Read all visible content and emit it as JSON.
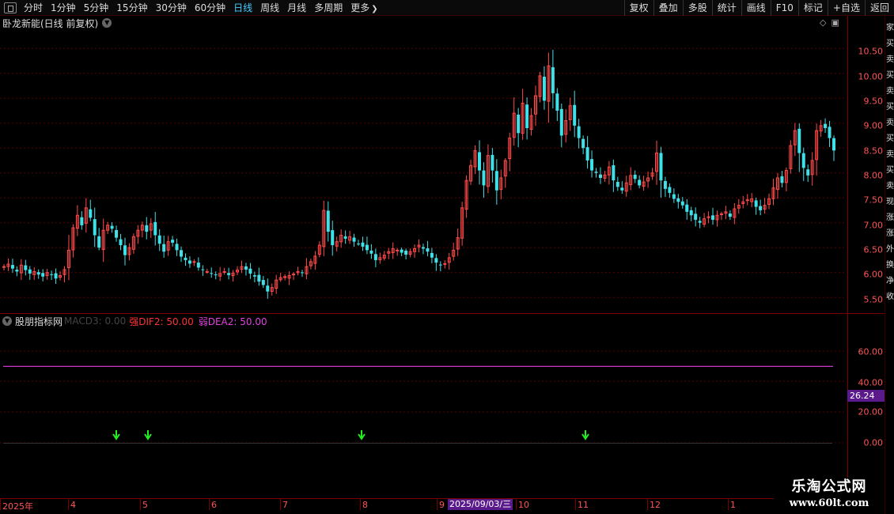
{
  "toolbar": {
    "periods": [
      "分时",
      "1分钟",
      "5分钟",
      "15分钟",
      "30分钟",
      "60分钟",
      "日线",
      "周线",
      "月线",
      "多周期",
      "更多"
    ],
    "active_period": "日线",
    "buttons": [
      "复权",
      "叠加",
      "多股",
      "统计",
      "画线",
      "F10",
      "标记",
      "+自选",
      "返回"
    ]
  },
  "main_chart": {
    "title": "卧龙新能(日线 前复权)",
    "price_ticks": [
      "10.50",
      "10.00",
      "9.50",
      "9.00",
      "8.50",
      "8.00",
      "7.50",
      "7.00",
      "6.50",
      "6.00",
      "5.50"
    ]
  },
  "indicator": {
    "name": "股朋指标网",
    "ghost_text": "MACD3: 0.00",
    "dif_label": "强DIF2: 50.00",
    "dea_label": "弱DEA2: 50.00",
    "ticks": [
      "60.00",
      "40.00",
      "20.00",
      "0.00"
    ],
    "current_value": "26.24",
    "dea_value": 50,
    "arrow_x": [
      147,
      187,
      457,
      740
    ]
  },
  "date_axis": {
    "labels": [
      "2025年",
      "4",
      "5",
      "6",
      "7",
      "8",
      "9",
      "10",
      "11",
      "12",
      "1"
    ],
    "cursor": "2025/09/03/三"
  },
  "side_strip": {
    "glyphs": [
      "家",
      "买",
      "卖",
      "买",
      "卖",
      "买",
      "卖",
      "买",
      "卖",
      "买",
      "卖",
      "现",
      "涨",
      "涨",
      "外",
      "换",
      "净",
      "收"
    ]
  },
  "watermark": {
    "title": "乐淘公式网",
    "url": "www.60lt.com"
  },
  "colors": {
    "up": "#ff4a4a",
    "down": "#40e0e8",
    "dea_line": "#e040e0",
    "arrow": "#22ee22",
    "grid": "#5a0000",
    "active_period": "#3fd0ff"
  },
  "chart_data": {
    "type": "candlestick",
    "price_range": [
      5.3,
      10.9
    ],
    "closes": [
      6.12,
      6.17,
      6.08,
      6.02,
      6.15,
      6.05,
      5.98,
      6.02,
      5.96,
      5.92,
      6.0,
      5.95,
      5.88,
      5.94,
      6.06,
      6.45,
      6.9,
      7.15,
      6.95,
      7.3,
      7.1,
      6.75,
      6.5,
      6.85,
      6.95,
      6.88,
      6.7,
      6.55,
      6.35,
      6.5,
      6.72,
      6.85,
      6.95,
      6.82,
      6.98,
      6.75,
      6.58,
      6.42,
      6.62,
      6.6,
      6.45,
      6.32,
      6.25,
      6.18,
      6.22,
      6.1,
      6.05,
      6.02,
      5.98,
      5.95,
      5.98,
      6.02,
      5.95,
      5.99,
      6.05,
      6.12,
      6.06,
      5.98,
      5.92,
      5.82,
      5.75,
      5.62,
      5.7,
      5.85,
      5.9,
      5.92,
      5.94,
      5.97,
      6.02,
      5.99,
      6.12,
      6.22,
      6.33,
      6.55,
      7.25,
      6.82,
      6.55,
      6.62,
      6.75,
      6.68,
      6.72,
      6.62,
      6.58,
      6.52,
      6.45,
      6.38,
      6.25,
      6.3,
      6.35,
      6.42,
      6.48,
      6.45,
      6.4,
      6.36,
      6.42,
      6.48,
      6.55,
      6.48,
      6.42,
      6.3,
      6.2,
      6.15,
      6.18,
      6.3,
      6.45,
      6.7,
      7.3,
      7.85,
      8.15,
      8.45,
      8.05,
      7.75,
      8.35,
      8.05,
      7.65,
      7.9,
      8.25,
      8.7,
      9.2,
      8.8,
      9.4,
      8.9,
      9.15,
      9.55,
      9.95,
      9.45,
      10.15,
      9.6,
      9.25,
      8.75,
      9.05,
      9.35,
      8.95,
      8.7,
      8.5,
      8.25,
      8.05,
      8.0,
      7.9,
      7.96,
      8.12,
      7.85,
      7.72,
      7.65,
      7.8,
      7.95,
      7.88,
      7.75,
      7.82,
      7.9,
      8.0,
      8.4,
      7.85,
      7.68,
      7.6,
      7.48,
      7.42,
      7.35,
      7.22,
      7.15,
      7.06,
      7.0,
      7.08,
      7.12,
      7.06,
      7.15,
      7.18,
      7.22,
      7.12,
      7.28,
      7.35,
      7.42,
      7.46,
      7.48,
      7.32,
      7.25,
      7.35,
      7.48,
      7.7,
      7.9,
      7.8,
      8.05,
      8.55,
      8.85,
      8.4,
      8.1,
      7.95,
      8.25,
      8.85,
      8.95,
      8.9,
      8.7,
      8.45
    ]
  }
}
